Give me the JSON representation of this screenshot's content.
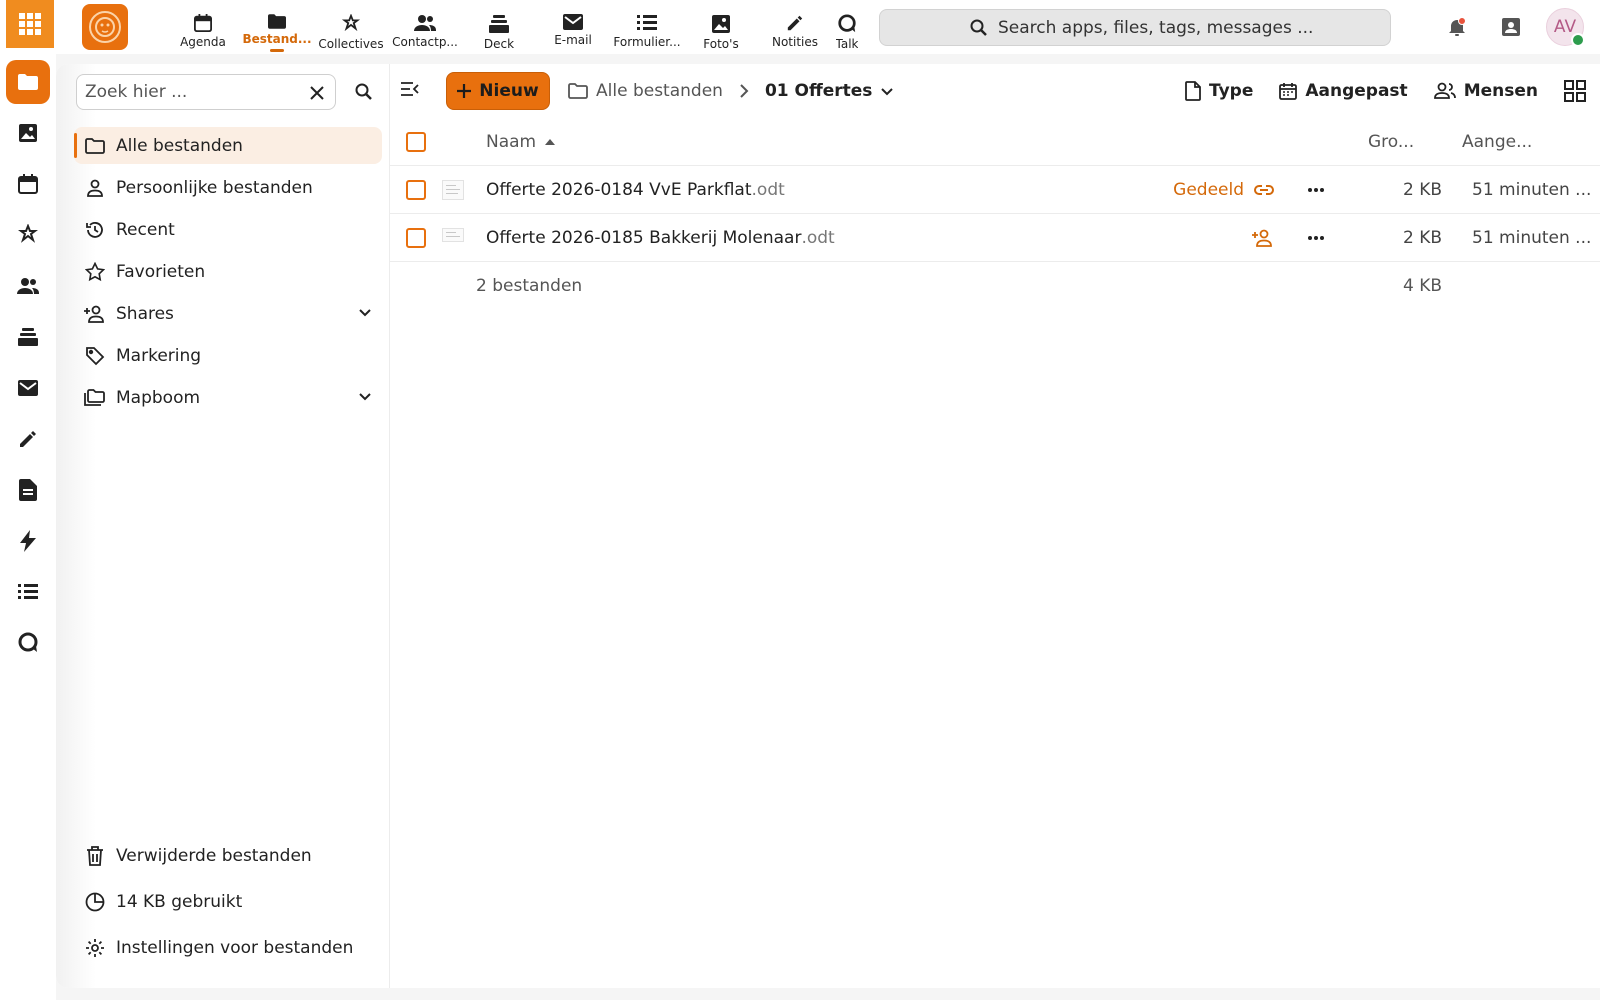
{
  "rail": {
    "items": [
      {
        "name": "files",
        "active": true
      },
      {
        "name": "photos"
      },
      {
        "name": "calendar"
      },
      {
        "name": "collectives"
      },
      {
        "name": "contacts"
      },
      {
        "name": "deck"
      },
      {
        "name": "mail"
      },
      {
        "name": "notes"
      },
      {
        "name": "text"
      },
      {
        "name": "activity"
      },
      {
        "name": "forms"
      },
      {
        "name": "talk"
      }
    ]
  },
  "topbar": {
    "nav": [
      {
        "label": "Agenda",
        "icon": "calendar-icon"
      },
      {
        "label": "Bestand...",
        "icon": "folder-icon",
        "active": true
      },
      {
        "label": "Collectives",
        "icon": "collectives-icon"
      },
      {
        "label": "Contactp...",
        "icon": "contacts-icon"
      },
      {
        "label": "Deck",
        "icon": "deck-icon"
      },
      {
        "label": "E-mail",
        "icon": "mail-icon"
      },
      {
        "label": "Formulier...",
        "icon": "list-icon"
      },
      {
        "label": "Foto's",
        "icon": "image-icon"
      },
      {
        "label": "Notities",
        "icon": "pencil-icon"
      },
      {
        "label": "Talk",
        "icon": "talk-icon"
      }
    ],
    "search_placeholder": "Search apps, files, tags, messages ...",
    "avatar_initials": "AV"
  },
  "sidebar": {
    "filter_placeholder": "Zoek hier ...",
    "items": [
      {
        "label": "Alle bestanden",
        "active": true
      },
      {
        "label": "Persoonlijke bestanden"
      },
      {
        "label": "Recent"
      },
      {
        "label": "Favorieten"
      },
      {
        "label": "Shares",
        "expandable": true
      },
      {
        "label": "Markering"
      },
      {
        "label": "Mapboom",
        "expandable": true
      }
    ],
    "bottom": {
      "trash": "Verwijderde bestanden",
      "quota": "14 KB gebruikt",
      "settings": "Instellingen voor bestanden"
    }
  },
  "toolbar": {
    "new_label": "Nieuw",
    "breadcrumb_root": "Alle bestanden",
    "breadcrumb_current": "01 Offertes",
    "filter_type": "Type",
    "filter_modified": "Aangepast",
    "filter_people": "Mensen"
  },
  "table": {
    "headers": {
      "name": "Naam",
      "size": "Gro...",
      "modified": "Aange..."
    },
    "rows": [
      {
        "base": "Offerte 2026-0184 VvE Parkflat",
        "ext": ".odt",
        "share": "Gedeeld",
        "share_icon": "link-icon",
        "size": "2 KB",
        "modified": "51 minuten ..."
      },
      {
        "base": "Offerte 2026-0185 Bakkerij Molenaar",
        "ext": ".odt",
        "share": "",
        "share_icon": "add-person-icon",
        "size": "2 KB",
        "modified": "51 minuten ..."
      }
    ],
    "footer": {
      "count": "2 bestanden",
      "total": "4 KB"
    }
  },
  "colors": {
    "accent": "#e8700e",
    "accent_text": "#d4690a"
  }
}
